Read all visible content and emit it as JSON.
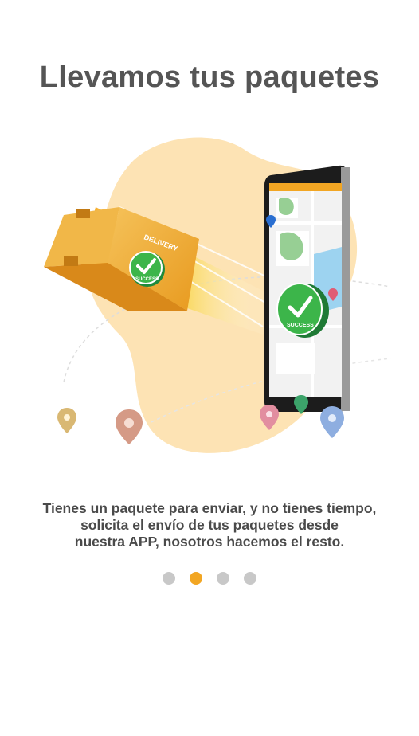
{
  "onboarding": {
    "title": "Llevamos tus paquetes",
    "description_lines": [
      "Tienes un paquete para enviar, y no tienes tiempo,",
      "solicita el envío de tus paquetes desde",
      "nuestra APP, nosotros hacemos el resto."
    ],
    "illustration": {
      "box_label": "DELIVERY",
      "badge_text": "SUCCESS",
      "phone_badge_text": "SUCCESS"
    },
    "pager": {
      "total": 4,
      "active_index": 1
    }
  },
  "colors": {
    "accent": "#f2a623",
    "inactive_dot": "#c8c8c8",
    "title": "#555555",
    "blob": "#fde3b4",
    "success_green": "#2ea043"
  }
}
